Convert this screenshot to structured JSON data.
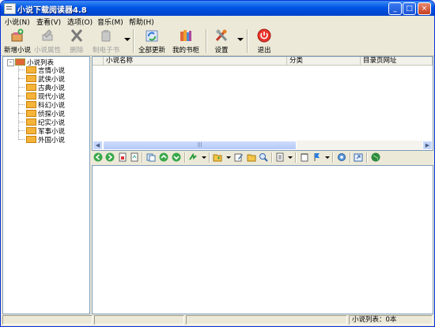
{
  "window": {
    "title": "小说下载阅读器4.8",
    "controls": {
      "minimize": "_",
      "maximize": "□",
      "close": "×"
    }
  },
  "menu": [
    {
      "label": "小说(N)"
    },
    {
      "label": "查看(V)"
    },
    {
      "label": "选项(O)"
    },
    {
      "label": "音乐(M)"
    },
    {
      "label": "帮助(H)"
    }
  ],
  "toolbar": {
    "new_novel": "新增小说",
    "novel_props": "小说属性",
    "delete": "删除",
    "make_ebook": "制电子书",
    "update_all": "全部更新",
    "my_shelf": "我的书柜",
    "settings": "设置",
    "exit": "退出"
  },
  "tree": {
    "root": "小说列表",
    "expander": "-",
    "children": [
      "言情小说",
      "武侠小说",
      "古典小说",
      "现代小说",
      "科幻小说",
      "侦探小说",
      "纪实小说",
      "军事小说",
      "外国小说"
    ]
  },
  "list": {
    "columns": [
      "小说名称",
      "分类",
      "目录页网址"
    ],
    "rows": []
  },
  "scrollbar": {
    "left": "◀",
    "right": "▶",
    "grip": "|||"
  },
  "nav_icons": [
    "back-icon",
    "forward-icon",
    "page-icon",
    "page-refresh-icon",
    "copy-page-icon",
    "up-icon",
    "down-icon",
    "download-icon",
    "folder-icon",
    "edit-icon",
    "open-folder-icon",
    "search-icon",
    "list-icon",
    "notepad-icon",
    "flag-icon",
    "gear-icon",
    "export-icon",
    "globe-icon"
  ],
  "statusbar": {
    "left": "",
    "middle": "",
    "middle2": "",
    "count": "小说列表：0本"
  },
  "colors": {
    "titlebar": "#0055e5",
    "face": "#ece9d8",
    "pane_border": "#7f9db9"
  }
}
